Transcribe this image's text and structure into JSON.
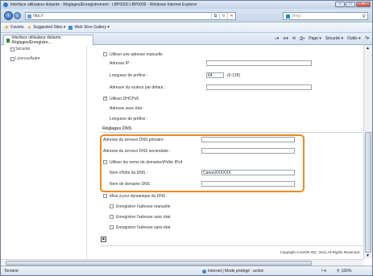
{
  "window": {
    "title": "Interface utilisateur distante : Réglages/Enregistrement : LBP0000 LBP0000 - Windows Internet Explorer"
  },
  "address": {
    "url": "http://",
    "search_placeholder": "Bing"
  },
  "favorites": {
    "label": "Favoris",
    "suggested": "Suggested Sites ▾",
    "gallery": "Web Slice Gallery ▾"
  },
  "tab": {
    "label": "Interface utilisateur distante : Réglages/Enregistre..."
  },
  "commands": {
    "page": "Page ▾",
    "security": "Sécurité ▾",
    "tools": "Outils ▾",
    "help": "?▾"
  },
  "sidebar": {
    "items": [
      {
        "label": "Sécurité"
      },
      {
        "label": "Licence/Autre"
      }
    ]
  },
  "form": {
    "manual_ip_label": "Utiliser une adresse manuelle",
    "ip_label": "Adresse IP :",
    "ip_value": "",
    "prefix_label": "Longueur de préfixe :",
    "prefix_value": "64",
    "prefix_range": "(0-128)",
    "gateway_label": "Adresse du routeur par défaut :",
    "gateway_value": "",
    "dhcp_label": "Utiliser DHCPv6",
    "stateful_label": "Adresse avec état :",
    "stateful_prefix_label": "Longueur de préfixe :",
    "dns_section": "Réglages DNS",
    "dns_primary_label": "Adresse du serveur DNS primaire :",
    "dns_primary_value": "",
    "dns_secondary_label": "Adresse du serveur DNS secondaire :",
    "dns_secondary_value": "",
    "ipv4_names_label": "Utiliser les noms de domaine/d'hôte IPv4",
    "host_label": "Nom d'hôte du DNS :",
    "host_value": "CanonXXXXXX",
    "domain_label": "Nom de domaine DNS :",
    "domain_value": "",
    "dyn_update_label": "Mise à jour dynamique du DNS",
    "reg_manual_label": "Enregistrer l'adresse manuelle",
    "reg_stateful_label": "Enregistrer l'adresse avec état",
    "reg_stateless_label": "Enregistrer l'adresse sans état",
    "copyright": "Copyright CANON INC. 2011 All Rights Reserved"
  },
  "status": {
    "left": "Terminé",
    "zone": "Internet | Mode protégé : activé",
    "zoom": "100%"
  }
}
